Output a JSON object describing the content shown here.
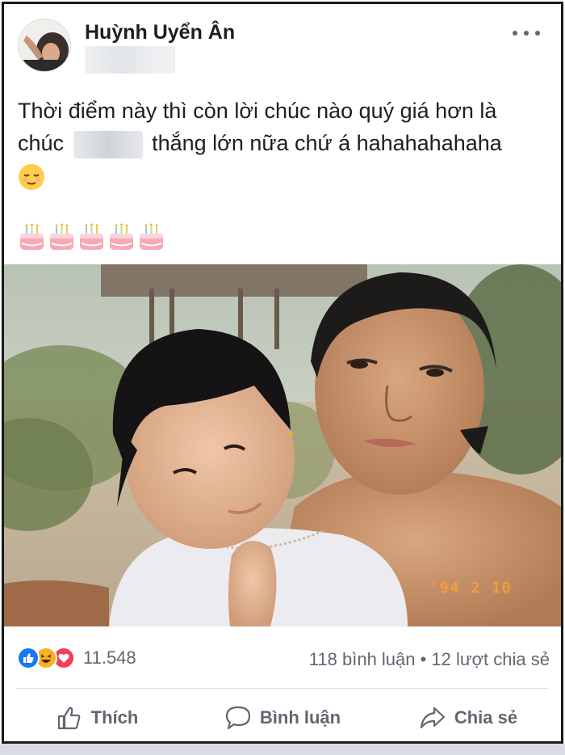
{
  "post": {
    "author": "Huỳnh Uyển Ân",
    "text_line1": "Thời điểm này thì còn lời chúc nào quý giá hơn là",
    "text_line2_start": "chúc",
    "text_line2_end": "thắng lớn nữa chứ á hahahahahaha",
    "photo_date_stamp": "'94 2 10"
  },
  "stats": {
    "reaction_count": "11.548",
    "comments_shares": "118 bình luận • 12 lượt chia sẻ"
  },
  "actions": {
    "like_label": "Thích",
    "comment_label": "Bình luận",
    "share_label": "Chia sẻ"
  },
  "icons": [
    "more-options-icon",
    "relieved-face-emoji-icon",
    "birthday-cake-emoji-icon",
    "like-reaction-icon",
    "haha-reaction-icon",
    "love-reaction-icon",
    "thumbs-up-icon",
    "comment-bubble-icon",
    "share-arrow-icon"
  ],
  "colors": {
    "like_blue": "#1877f2",
    "love_red": "#f33e58",
    "haha_yellow": "#f7b125",
    "secondary_text": "#606770",
    "date_stamp_orange": "#f2a24a"
  }
}
